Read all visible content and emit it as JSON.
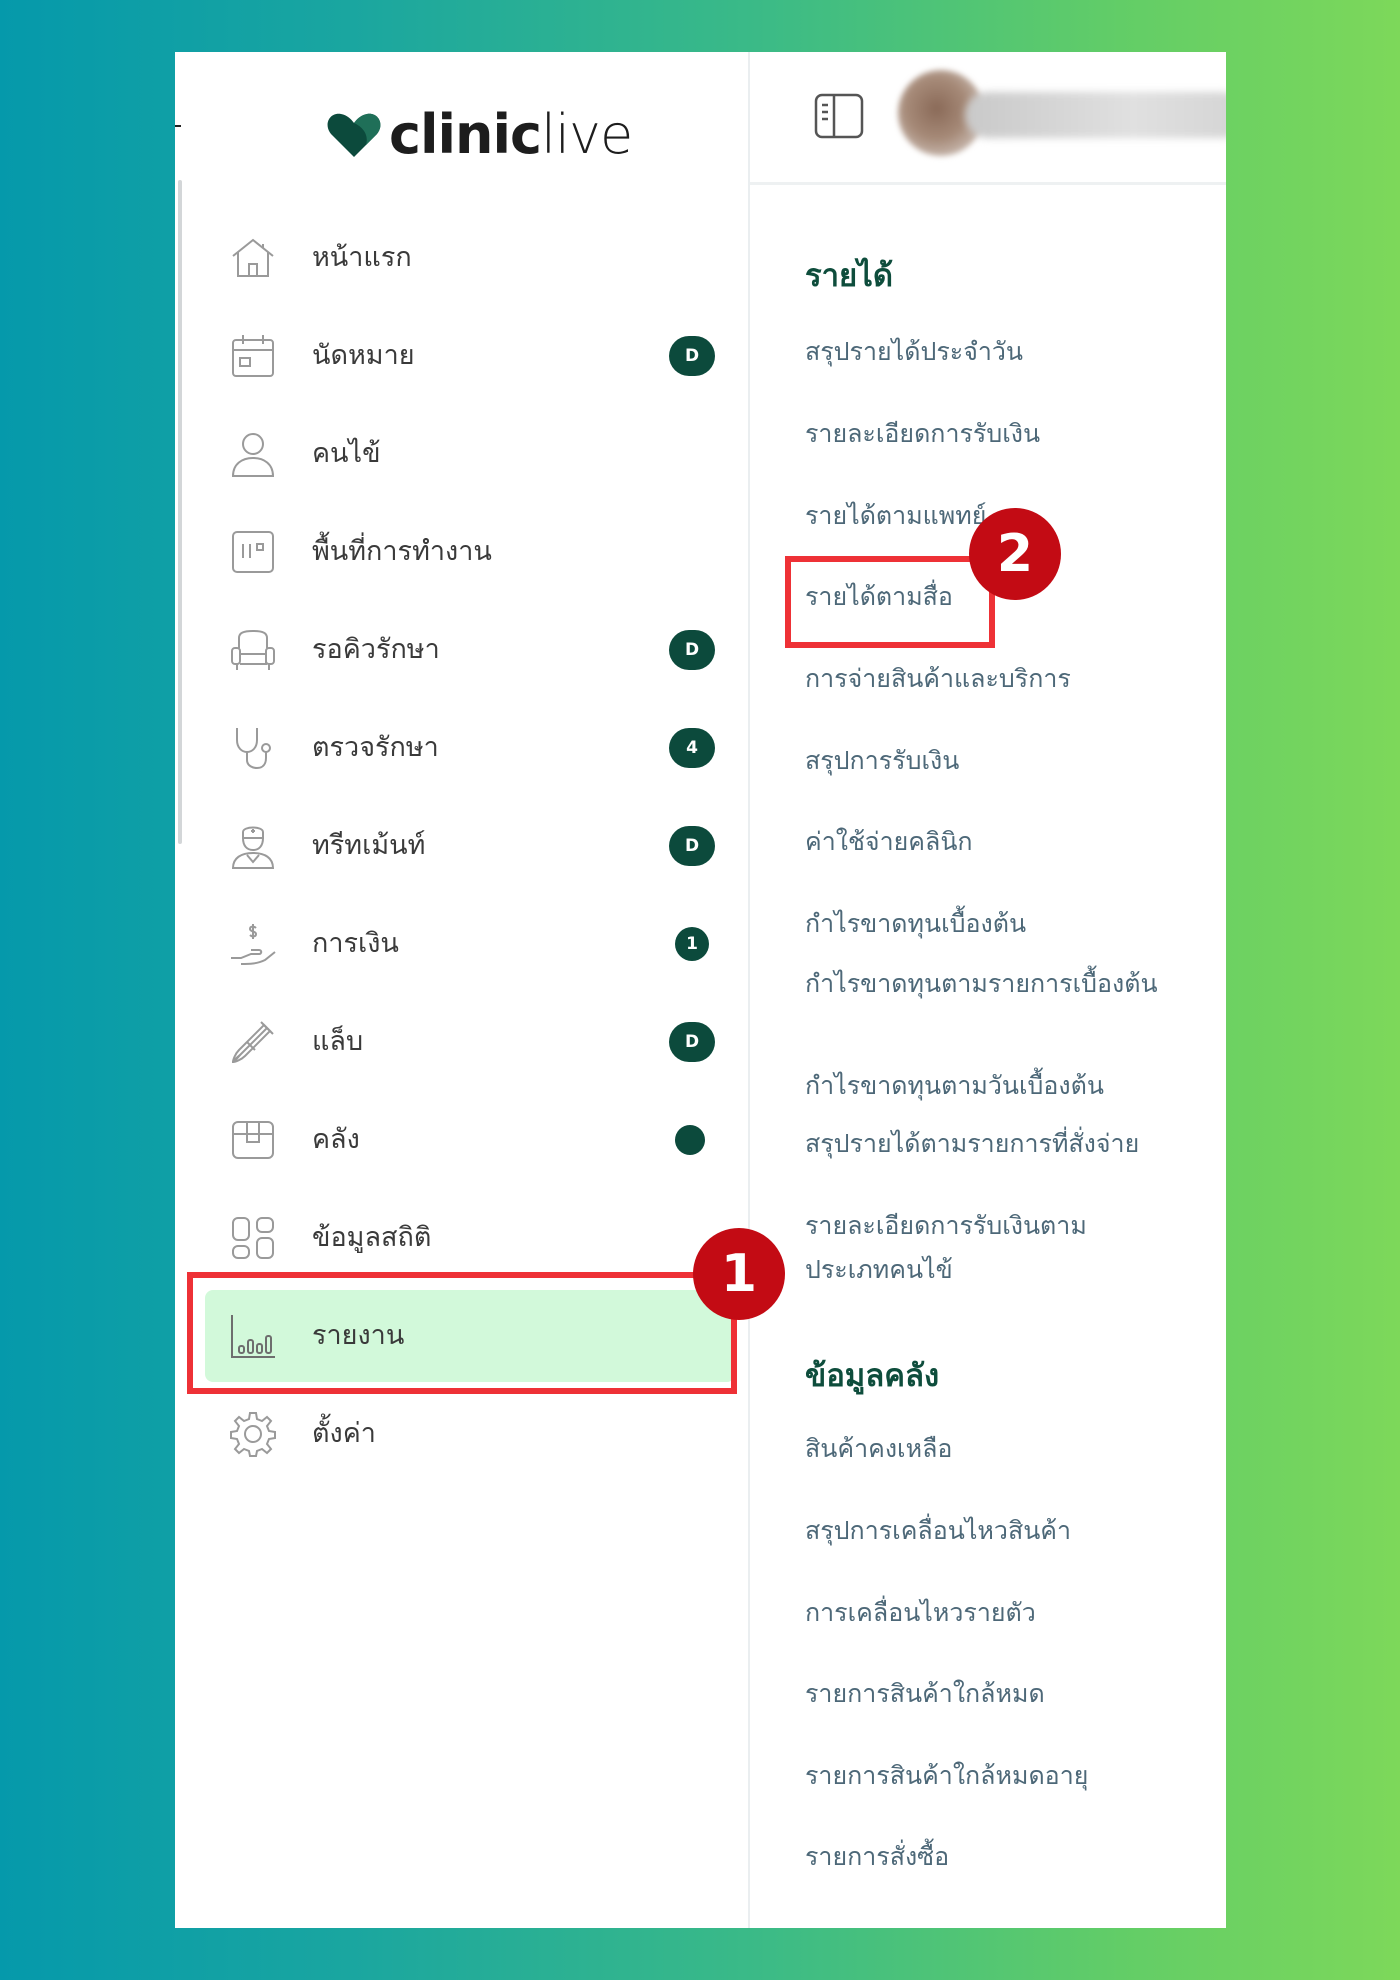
{
  "brand": {
    "bold": "clinic",
    "light": "live",
    "color": "#0c4a3c"
  },
  "sidebar": {
    "items": [
      {
        "label": "หน้าแรก",
        "icon": "home-icon",
        "badge": ""
      },
      {
        "label": "นัดหมาย",
        "icon": "calendar-icon",
        "badge": "D"
      },
      {
        "label": "คนไข้",
        "icon": "user-icon",
        "badge": ""
      },
      {
        "label": "พื้นที่การทำงาน",
        "icon": "workspace-icon",
        "badge": ""
      },
      {
        "label": "รอคิวรักษา",
        "icon": "waiting-chair-icon",
        "badge": "D"
      },
      {
        "label": "ตรวจรักษา",
        "icon": "stethoscope-icon",
        "badge": "4"
      },
      {
        "label": "ทรีทเม้นท์",
        "icon": "nurse-icon",
        "badge": "D"
      },
      {
        "label": "การเงิน",
        "icon": "money-hand-icon",
        "badge": "1"
      },
      {
        "label": "แล็บ",
        "icon": "test-tube-icon",
        "badge": "D"
      },
      {
        "label": "คลัง",
        "icon": "box-icon",
        "badge": ""
      },
      {
        "label": "ข้อมูลสถิติ",
        "icon": "stats-grid-icon",
        "badge": ""
      },
      {
        "label": "รายงาน",
        "icon": "bar-chart-icon",
        "badge": ""
      },
      {
        "label": "ตั้งค่า",
        "icon": "gear-icon",
        "badge": ""
      }
    ],
    "active_index": 11,
    "active_bg": "#d2f9da"
  },
  "report_menu": {
    "income_title": "รายได้",
    "income_links": [
      "สรุปรายได้ประจำวัน",
      "รายละเอียดการรับเงิน",
      "รายได้ตามแพทย์",
      "รายได้ตามสื่อ",
      "การจ่ายสินค้าและบริการ",
      "สรุปการรับเงิน",
      "ค่าใช้จ่ายคลินิก",
      "กำไรขาดทุนเบื้องต้น",
      "กำไรขาดทุนตามรายการเบื้องต้น",
      "กำไรขาดทุนตามวันเบื้องต้น",
      "สรุปรายได้ตามรายการที่สั่งจ่าย",
      "รายละเอียดการรับเงินตามประเภทคนไข้"
    ],
    "stock_title": "ข้อมูลคลัง",
    "stock_links": [
      "สินค้าคงเหลือ",
      "สรุปการเคลื่อนไหวสินค้า",
      "การเคลื่อนไหวรายตัว",
      "รายการสินค้าใกล้หมด",
      "รายการสินค้าใกล้หมดอายุ",
      "รายการสั่งซื้อ"
    ]
  },
  "callouts": {
    "step1": "1",
    "step2": "2",
    "color": "#ee3136"
  }
}
